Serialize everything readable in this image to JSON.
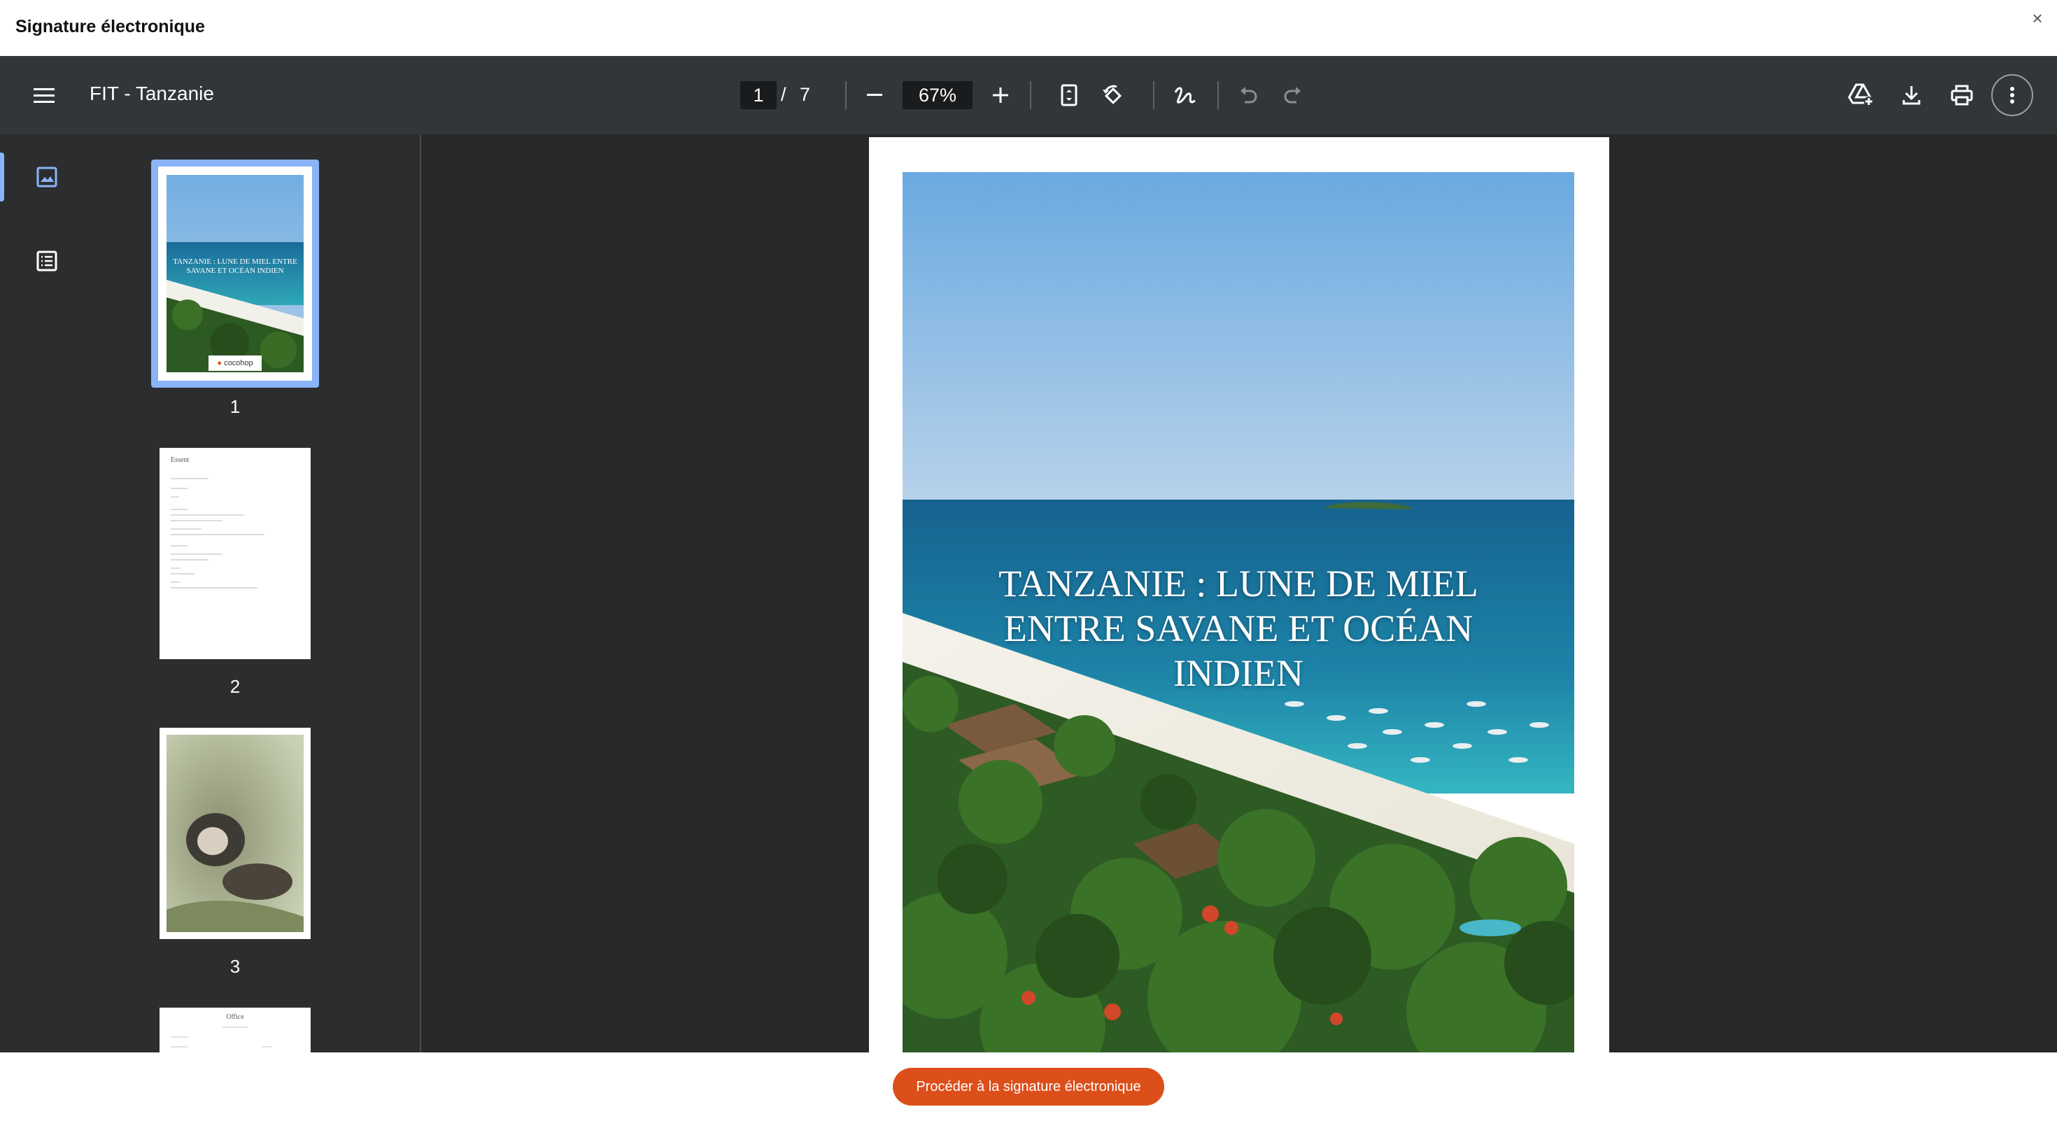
{
  "modal": {
    "title": "Signature électronique",
    "close_label": "×"
  },
  "toolbar": {
    "doc_title": "FIT - Tanzanie",
    "page_current": "1",
    "page_sep": "/",
    "page_total": "7",
    "zoom": "67%"
  },
  "sidebar": {
    "thumbnails": [
      {
        "label": "1"
      },
      {
        "label": "2"
      },
      {
        "label": "3"
      }
    ]
  },
  "document": {
    "cover_title_lines": [
      "TANZANIE : LUNE DE MIEL",
      "ENTRE SAVANE ET OCÉAN",
      "INDIEN"
    ],
    "thumb1_title": "TANZANIE : LUNE DE MIEL ENTRE SAVANE ET OCÉAN INDIEN",
    "thumb1_logo": "cocohop",
    "thumb2_heading": "Essent",
    "thumb4_heading": "Office"
  },
  "footer": {
    "cta_label": "Procéder à la signature électronique"
  },
  "colors": {
    "accent": "#dc4f1a",
    "toolbar": "#323639",
    "sidebar": "#2b2d2f",
    "selection": "#8ab4f8"
  }
}
